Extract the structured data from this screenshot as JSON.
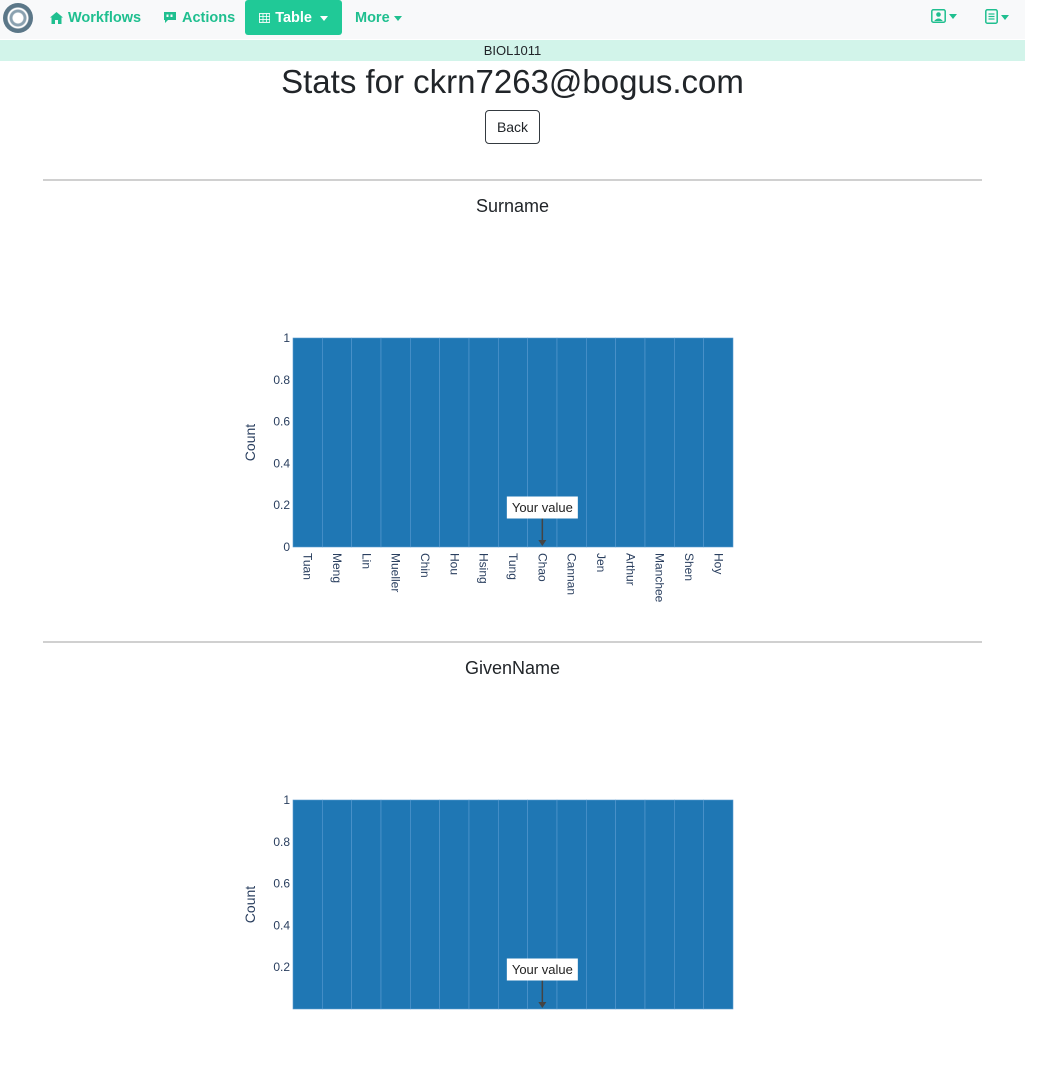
{
  "navbar": {
    "workflows": "Workflows",
    "actions": "Actions",
    "table": "Table",
    "more": "More",
    "icons": [
      "home-icon",
      "comment-action-icon",
      "table-icon",
      "user-profile-icon",
      "document-icon"
    ]
  },
  "course": "BIOL1011",
  "page_title": "Stats for ckrn7263@bogus.com",
  "back_label": "Back",
  "colors": {
    "accent": "#20c997",
    "bar": "#1f77b4",
    "course_bar": "#d2f4ea"
  },
  "sections": [
    {
      "title": "Surname"
    },
    {
      "title": "GivenName"
    }
  ],
  "chart_data": [
    {
      "type": "bar",
      "title": "Surname",
      "xlabel": "",
      "ylabel": "Count",
      "ylim": [
        0,
        1
      ],
      "yticks": [
        "0",
        "0.2",
        "0.4",
        "0.6",
        "0.8",
        "1"
      ],
      "categories": [
        "Tuan",
        "Meng",
        "Lin",
        "Mueller",
        "Chin",
        "Hou",
        "Hsing",
        "Tung",
        "Chao",
        "Cannan",
        "Jen",
        "Arthur",
        "Manchee",
        "Shen",
        "Hoy"
      ],
      "values": [
        1,
        1,
        1,
        1,
        1,
        1,
        1,
        1,
        1,
        1,
        1,
        1,
        1,
        1,
        1
      ],
      "annotation": {
        "text": "Your value",
        "category": "Chao"
      }
    },
    {
      "type": "bar",
      "title": "GivenName",
      "xlabel": "",
      "ylabel": "Count",
      "ylim": [
        0,
        1
      ],
      "yticks": [
        "0.2",
        "0.4",
        "0.6",
        "0.8",
        "1"
      ],
      "categories": [],
      "values": [
        1,
        1,
        1,
        1,
        1,
        1,
        1,
        1,
        1,
        1,
        1,
        1,
        1,
        1,
        1
      ],
      "annotation": {
        "text": "Your value",
        "category_index": 8
      }
    }
  ]
}
